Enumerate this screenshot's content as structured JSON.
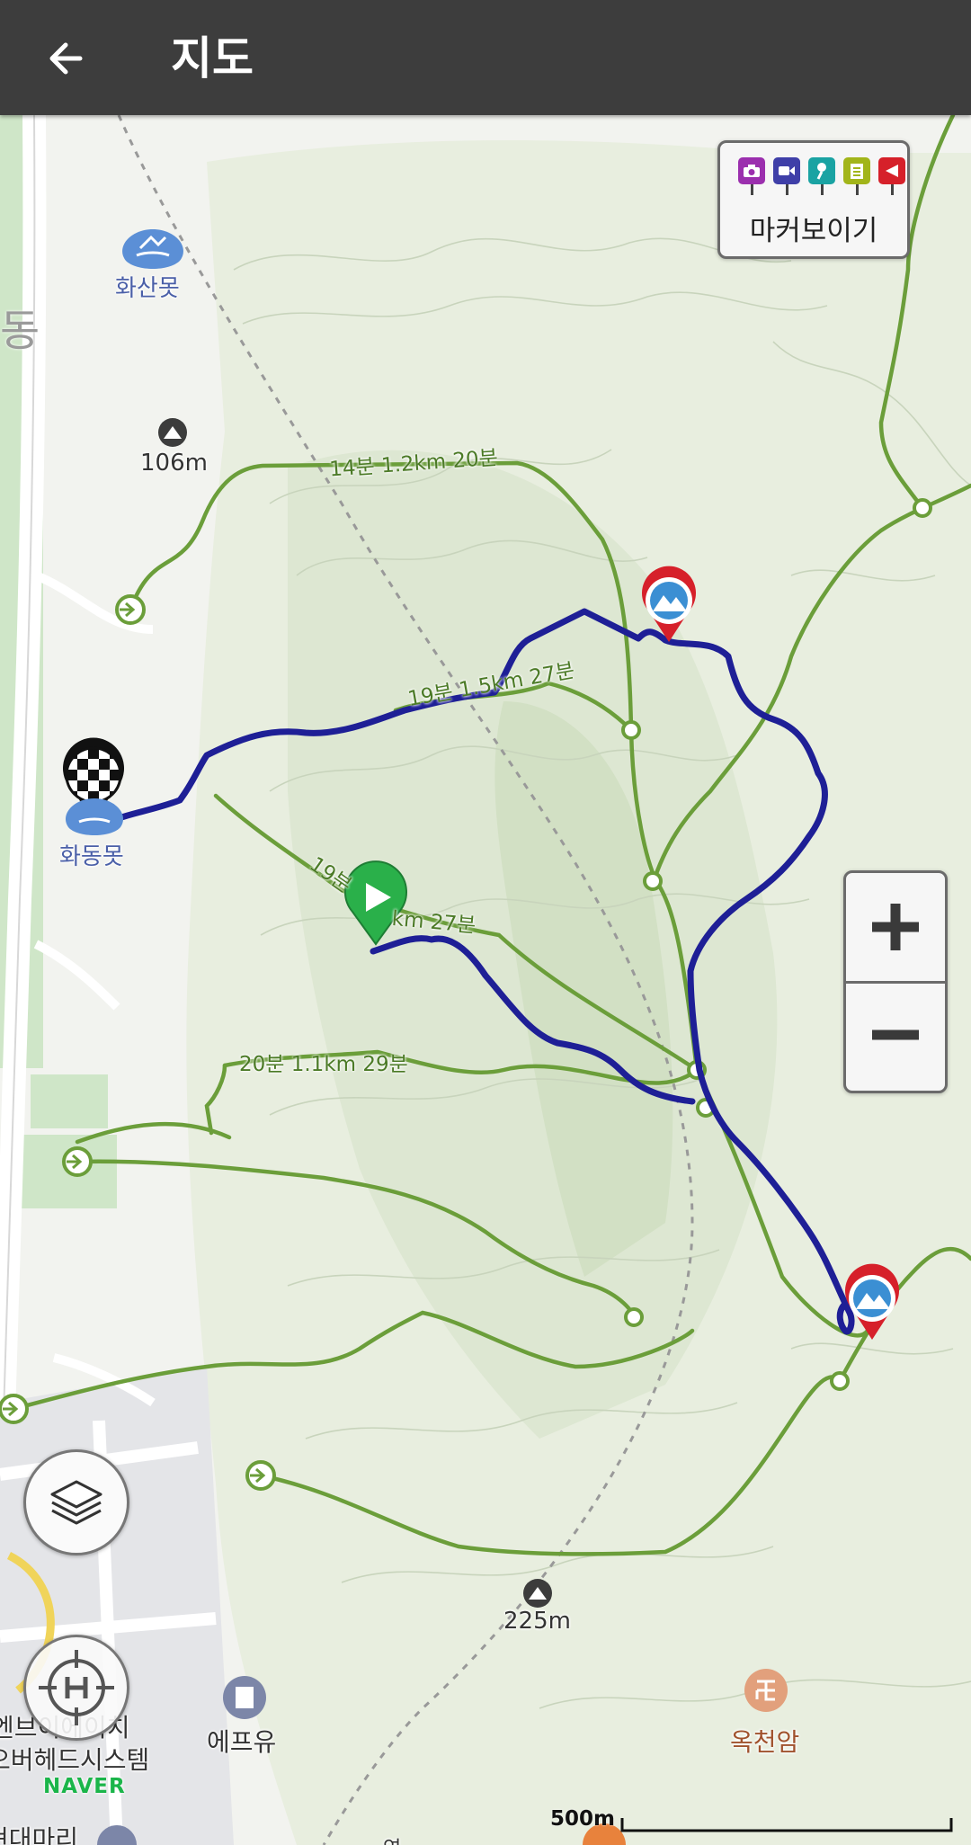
{
  "header": {
    "title": "지도",
    "back_icon": "arrow-left-icon"
  },
  "marker_toggle": {
    "label": "마커보이기",
    "icons": [
      {
        "name": "camera-marker-icon",
        "color": "#9b2fae"
      },
      {
        "name": "video-marker-icon",
        "color": "#3f3fa8"
      },
      {
        "name": "audio-marker-icon",
        "color": "#1aa3a3"
      },
      {
        "name": "memo-marker-icon",
        "color": "#a2b51a"
      },
      {
        "name": "alert-marker-icon",
        "color": "#d6202a"
      }
    ]
  },
  "zoom": {
    "in_label": "+",
    "out_label": "−"
  },
  "map": {
    "poi": {
      "pond_north": "화산못",
      "pond_west": "화동못"
    },
    "district": "동",
    "peaks": {
      "north": "106m",
      "south": "225m"
    },
    "buildings": {
      "b1": "에프유",
      "b2": "엔브이에이치",
      "b3": "오버헤드시스템",
      "b4": "현대마리",
      "b5": "연"
    },
    "temple": "옥천암",
    "trail_labels": {
      "t1": "14분 1.2km 20분",
      "t2": "19분 1.5km 27분",
      "t3a": "19분",
      "t3b": "km 27분",
      "t4": "20분 1.1km 29분"
    },
    "brand": "NAVER",
    "scale": "500m"
  },
  "colors": {
    "track": "#1e1f96",
    "trail": "#6b9e3a",
    "header_bg": "#3d3d3d",
    "start_marker": "#2ab04a",
    "peak_marker": "#d6202a"
  }
}
